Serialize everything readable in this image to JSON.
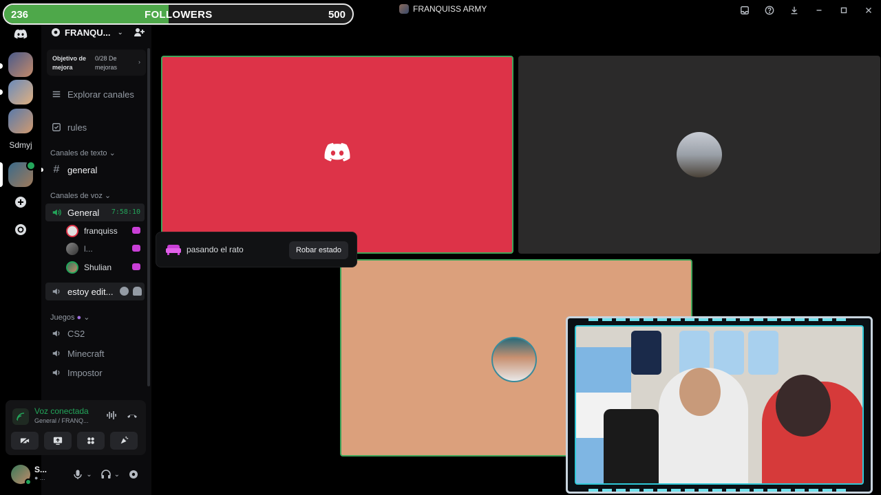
{
  "followers": {
    "current": "236",
    "label": "FOLLOWERS",
    "goal": "500",
    "progress": 0.472
  },
  "window": {
    "title": "FRANQUISS ARMY"
  },
  "rail": {
    "text_server": "Sdmyj"
  },
  "server": {
    "name": "FRANQU...",
    "boost": {
      "label": "Objetivo de mejora",
      "value": "0/28 De mejoras"
    }
  },
  "channels": {
    "explore": "Explorar canales",
    "rules": "rules",
    "text_category": "Canales de texto",
    "general_text": "general",
    "voice_category": "Canales de voz",
    "general_voice": "General",
    "timer": "7:58:10",
    "members": [
      "franquiss",
      "l...",
      "Shulian"
    ],
    "estoy_edit": "estoy edit...",
    "games_category": "Juegos",
    "cs2": "CS2",
    "minecraft": "Minecraft",
    "impostor": "Impostor"
  },
  "voice": {
    "title": "Voz conectada",
    "sub": "General / FRANQ..."
  },
  "user": {
    "name": "S...",
    "sub": "● ..."
  },
  "popover": {
    "text": "pasando el rato",
    "button": "Robar estado"
  },
  "colors": {
    "accent_green": "#23a55a",
    "tile_red": "#dd3348",
    "tile_peach": "#dba07c",
    "tile_dark": "#2b2a2a",
    "activity_pink": "#c93fd6"
  }
}
